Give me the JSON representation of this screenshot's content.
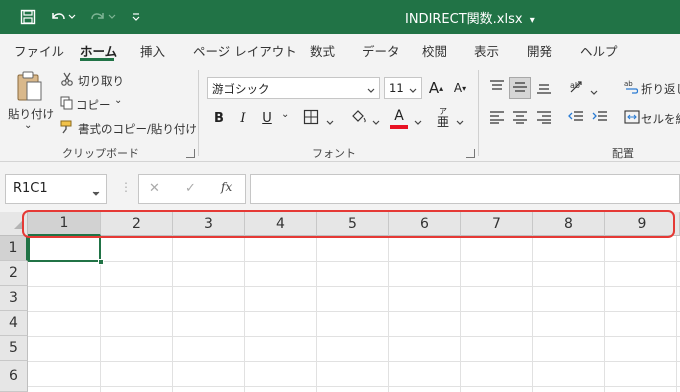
{
  "window": {
    "title": "INDIRECT関数.xlsx",
    "title_dropdown": "▾"
  },
  "menu": {
    "items": [
      "ファイル",
      "ホーム",
      "挿入",
      "ページ レイアウト",
      "数式",
      "データ",
      "校閲",
      "表示",
      "開発",
      "ヘルプ"
    ],
    "active": "ホーム"
  },
  "clipboard": {
    "paste_label": "貼り付け",
    "paste_caret": "⌄",
    "cut_label": "切り取り",
    "copy_label": "コピー",
    "copy_caret": "⌄",
    "format_painter_label": "書式のコピー/貼り付け",
    "group_label": "クリップボード"
  },
  "font": {
    "name": "游ゴシック",
    "size": "11",
    "grow_label": "A",
    "shrink_label": "A",
    "bold": "B",
    "italic": "I",
    "underline": "U",
    "underline_caret": "⌄",
    "font_color_letter": "A",
    "font_color": "#e81123",
    "phonetic_label": "ア",
    "group_label": "フォント"
  },
  "alignment": {
    "wrap_text_label": "折り返し",
    "merge_label": "セルを結",
    "group_label": "配置"
  },
  "formula_bar": {
    "name_box": "R1C1",
    "cancel": "✕",
    "enter": "✓",
    "fx": "fx",
    "value": ""
  },
  "grid": {
    "columns": [
      "1",
      "2",
      "3",
      "4",
      "5",
      "6",
      "7",
      "8",
      "9"
    ],
    "rows": [
      "1",
      "2",
      "3",
      "4",
      "5",
      "6"
    ],
    "selected_cell": "R1C1"
  },
  "colors": {
    "brand": "#217346",
    "highlight": "#e53935"
  }
}
